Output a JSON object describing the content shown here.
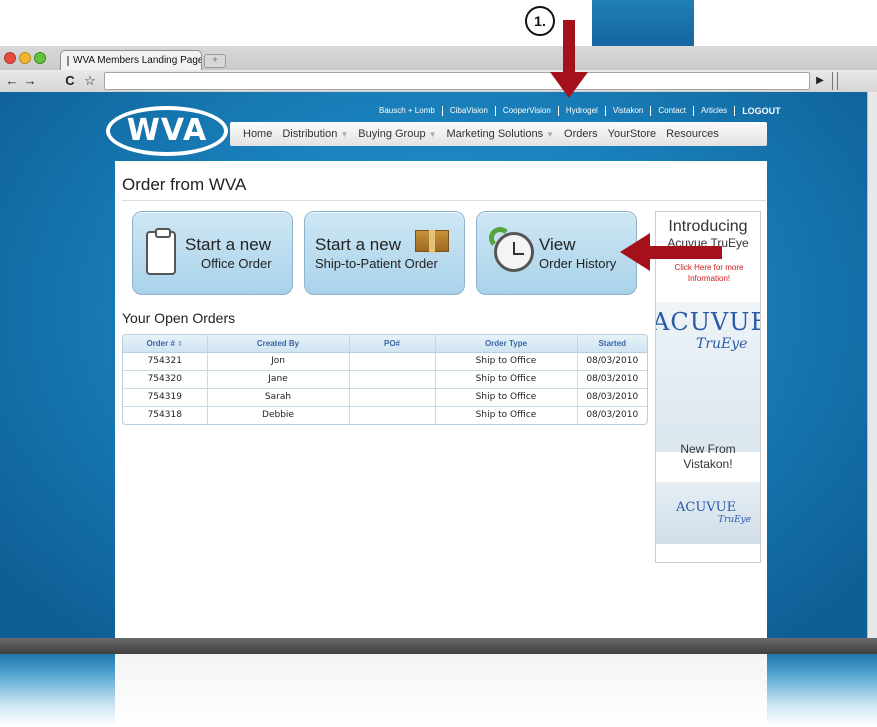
{
  "annotation": {
    "step_label": "1."
  },
  "browser": {
    "tab_title": "WVA Members Landing Page",
    "tab_close": "×",
    "new_tab": "+",
    "back": "←",
    "forward": "→",
    "reload": "C",
    "bookmark": "☆",
    "url": "",
    "go": "▶"
  },
  "site": {
    "logo": "WVA",
    "top_links": [
      "Bausch + Lomb",
      "CibaVision",
      "CooperVision",
      "Hydrogel",
      "Vistakon",
      "Contact",
      "Articles",
      "LOGOUT"
    ],
    "nav": [
      {
        "label": "Home",
        "dropdown": false
      },
      {
        "label": "Distribution",
        "dropdown": true
      },
      {
        "label": "Buying Group",
        "dropdown": true
      },
      {
        "label": "Marketing Solutions",
        "dropdown": true
      },
      {
        "label": "Orders",
        "dropdown": false
      },
      {
        "label": "YourStore",
        "dropdown": false
      },
      {
        "label": "Resources",
        "dropdown": false
      }
    ],
    "dropdown_glyph": "▼"
  },
  "main": {
    "title": "Order from WVA",
    "buttons": {
      "office": {
        "line1": "Start a new",
        "line2": "Office Order"
      },
      "patient": {
        "line1": "Start a new",
        "line2": "Ship-to-Patient Order"
      },
      "history": {
        "line1": "View",
        "line2": "Order History"
      }
    },
    "open_orders_title": "Your Open Orders",
    "table": {
      "headers": [
        "Order #",
        "Created By",
        "PO#",
        "Order Type",
        "Started"
      ],
      "sort_glyph": "⇕",
      "rows": [
        [
          "754321",
          "Jon",
          "",
          "Ship to Office",
          "08/03/2010"
        ],
        [
          "754320",
          "Jane",
          "",
          "Ship to Office",
          "08/03/2010"
        ],
        [
          "754319",
          "Sarah",
          "",
          "Ship to Office",
          "08/03/2010"
        ],
        [
          "754318",
          "Debbie",
          "",
          "Ship to Office",
          "08/03/2010"
        ]
      ]
    }
  },
  "ad": {
    "headline": "Introducing",
    "product": "Acuvue TruEye",
    "cta": "Click Here for more Information!",
    "brand": "ACUVUE",
    "brand_sub": "TruEye",
    "new_from": "New From Vistakon!",
    "brand2": "ACUVUE",
    "brand2_sub": "TruEye"
  },
  "colors": {
    "accent_blue": "#1a82bd",
    "arrow_red": "#a4111b",
    "table_header_text": "#3a66a4",
    "ad_red": "#cc1a1a"
  }
}
